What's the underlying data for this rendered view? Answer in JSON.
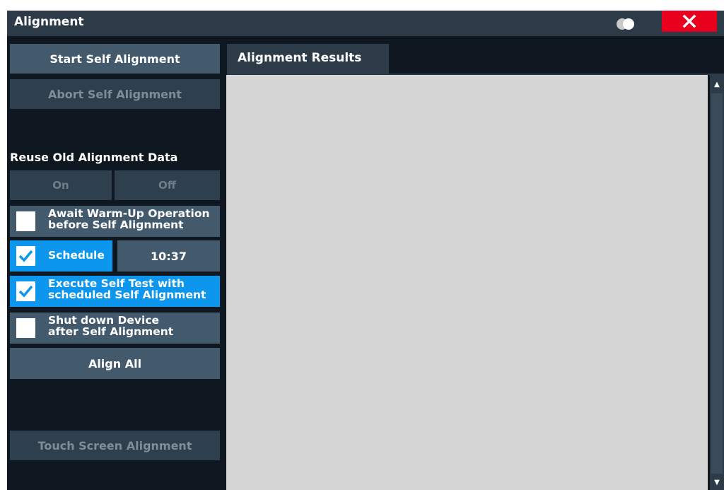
{
  "window": {
    "title": "Alignment"
  },
  "left": {
    "start_label": "Start Self Alignment",
    "abort_label": "Abort Self Alignment",
    "reuse_label": "Reuse Old Alignment Data",
    "reuse_on": "On",
    "reuse_off": "Off",
    "await_line1": "Await Warm-Up Operation",
    "await_line2": "before Self Alignment",
    "await_checked": false,
    "schedule_label": "Schedule",
    "schedule_checked": true,
    "schedule_time": "10:37",
    "selftest_line1": "Execute Self Test with",
    "selftest_line2": "scheduled Self Alignment",
    "selftest_checked": true,
    "shutdown_line1": "Shut down Device",
    "shutdown_line2": "after Self Alignment",
    "shutdown_checked": false,
    "align_all_label": "Align All",
    "touch_label": "Touch Screen Alignment"
  },
  "results": {
    "tab_label": "Alignment Results"
  },
  "icons": {
    "close": "close-icon",
    "toggle": "toggle-icon",
    "checkmark": "checkmark-icon",
    "scroll_up": "scroll-up-icon",
    "scroll_down": "scroll-down-icon"
  },
  "colors": {
    "title_bar": "#2d3b48",
    "button": "#435a6d",
    "checked": "#0d96ed",
    "close": "#e8001d",
    "panel": "#d6d6d6"
  }
}
